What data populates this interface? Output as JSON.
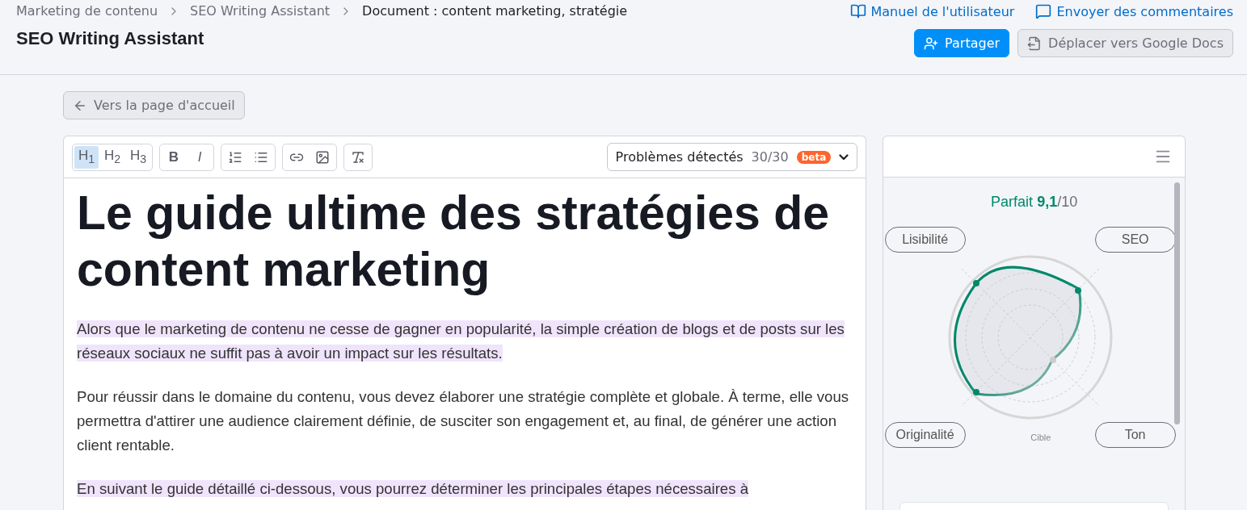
{
  "breadcrumbs": [
    {
      "label": "Marketing de contenu"
    },
    {
      "label": "SEO Writing Assistant"
    },
    {
      "label": "Document : content marketing, stratégie"
    }
  ],
  "page_title": "SEO Writing Assistant",
  "header_links": [
    {
      "kind": "manual",
      "label": "Manuel de l'utilisateur"
    },
    {
      "kind": "feedback",
      "label": "Envoyer des commentaires"
    }
  ],
  "header_buttons": [
    {
      "kind": "share",
      "label": "Partager"
    },
    {
      "kind": "move",
      "label": "Déplacer vers Google Docs"
    }
  ],
  "back_button": "Vers la page d'accueil",
  "toolbar": [
    [
      {
        "kind": "heading",
        "label": "H$_{1}$",
        "selected": true
      },
      {
        "kind": "heading",
        "label": "H$_{2}$",
        "selected": false
      },
      {
        "kind": "heading",
        "label": "H$_{3}$",
        "selected": false
      }
    ],
    [
      {
        "kind": "bold",
        "label": "B",
        "selected": false
      },
      {
        "kind": "italic",
        "label": "I",
        "selected": false
      }
    ],
    [
      {
        "kind": "ordered-list",
        "selected": false
      },
      {
        "kind": "bullet-list",
        "selected": false
      }
    ],
    [
      {
        "kind": "link",
        "selected": false
      },
      {
        "kind": "image",
        "selected": false
      }
    ],
    [
      {
        "kind": "clear-format",
        "selected": false
      }
    ]
  ],
  "issues": {
    "label": "Problèmes détectés",
    "count": "30/30",
    "badge": "beta"
  },
  "document": {
    "title": "Le guide ultime des stratégies de content marketing",
    "paragraphs": [
      {
        "text": "Alors que le marketing de contenu ne cesse de gagner en popularité, la simple création de blogs et de posts sur les réseaux sociaux ne suffit pas à avoir un impact sur les résultats.",
        "highlighted": true
      },
      {
        "text": "Pour réussir dans le domaine du contenu, vous devez élaborer une stratégie complète et globale. À terme, elle vous permettra d'attirer une audience clairement définie, de susciter son engagement et, au final, de générer une action client rentable.",
        "highlighted": false
      },
      {
        "text": "En suivant le guide détaillé ci-dessous, vous pourrez déterminer les principales étapes nécessaires à",
        "highlighted": true
      }
    ]
  },
  "score": {
    "label": "Parfait",
    "value": "9,1",
    "max": "/10"
  },
  "axes": [
    {
      "label": "Lisibilité"
    },
    {
      "label": "SEO"
    },
    {
      "label": "Originalité"
    },
    {
      "label": "Ton"
    }
  ],
  "target_label": "Cible"
}
